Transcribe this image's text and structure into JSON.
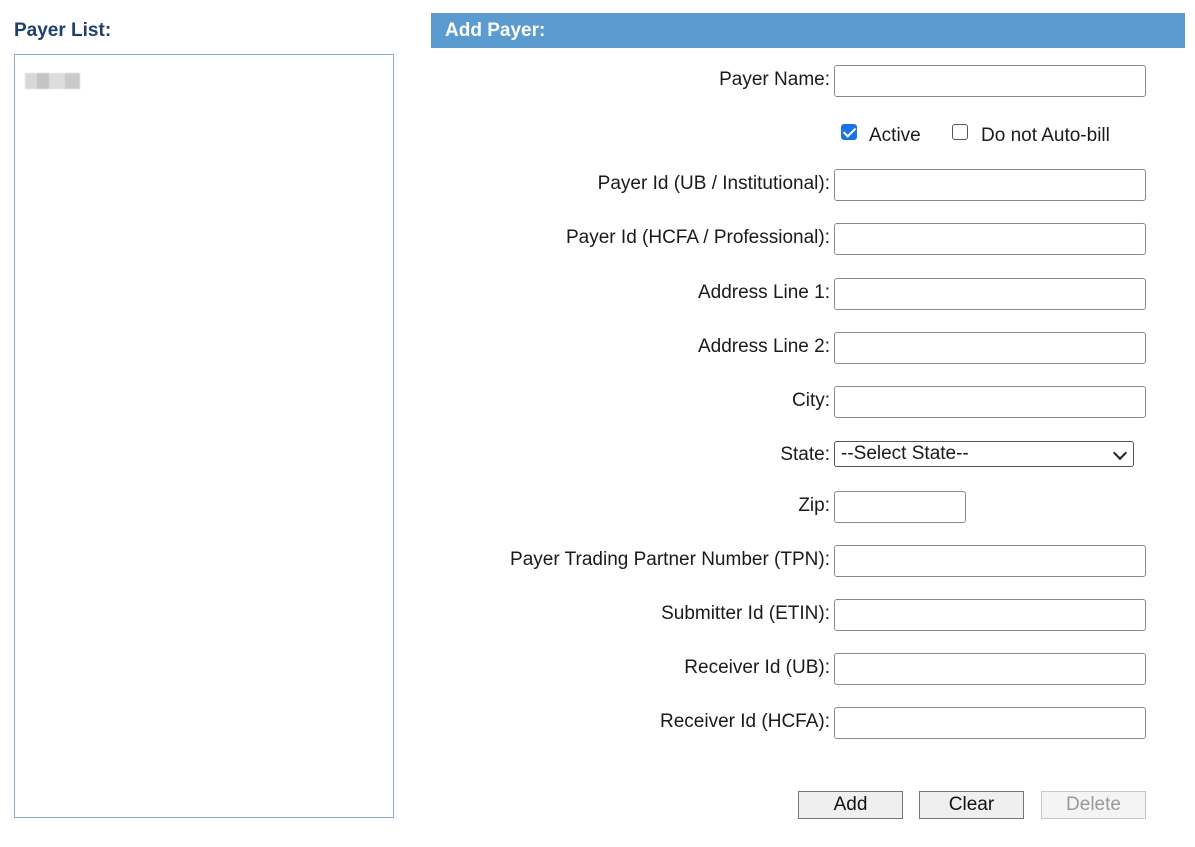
{
  "payer_list": {
    "title": "Payer List:"
  },
  "form": {
    "header": "Add Payer:",
    "fields": {
      "payer_name": {
        "label": "Payer Name:",
        "value": ""
      },
      "payer_id_ub": {
        "label": "Payer Id (UB / Institutional):",
        "value": ""
      },
      "payer_id_hcfa": {
        "label": "Payer Id (HCFA / Professional):",
        "value": ""
      },
      "address1": {
        "label": "Address Line 1:",
        "value": ""
      },
      "address2": {
        "label": "Address Line 2:",
        "value": ""
      },
      "city": {
        "label": "City:",
        "value": ""
      },
      "state": {
        "label": "State:",
        "selected": "--Select State--"
      },
      "zip": {
        "label": "Zip:",
        "value": ""
      },
      "tpn": {
        "label": "Payer Trading Partner Number (TPN):",
        "value": ""
      },
      "etin": {
        "label": "Submitter Id (ETIN):",
        "value": ""
      },
      "receiver_ub": {
        "label": "Receiver Id (UB):",
        "value": ""
      },
      "receiver_hcfa": {
        "label": "Receiver Id (HCFA):",
        "value": ""
      }
    },
    "checkboxes": {
      "active": {
        "label": "Active",
        "checked": true
      },
      "no_autobill": {
        "label": "Do not Auto-bill",
        "checked": false
      }
    },
    "buttons": {
      "add": {
        "label": "Add",
        "enabled": true
      },
      "clear": {
        "label": "Clear",
        "enabled": true
      },
      "delete": {
        "label": "Delete",
        "enabled": false
      }
    }
  },
  "colors": {
    "header_bg": "#5b9bcf",
    "list_title": "#1f3f6e",
    "checkbox_checked": "#1a73e8"
  }
}
